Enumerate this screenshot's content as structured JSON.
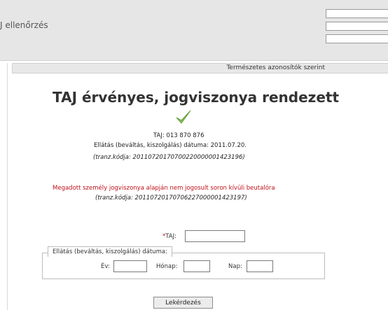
{
  "header": {
    "title": "J ellenőrzés"
  },
  "tabs": {
    "active_label": "Természetes azonosítók szerint"
  },
  "result": {
    "title": "TAJ érvényes, jogviszonya rendezett",
    "taj_line": "TAJ: 013 870 876",
    "date_line": "Ellátás (beváltás, kiszolgálás) dátuma: 2011.07.20.",
    "tranz1": "(tranz.kódja: 20110720170700220000001423196)",
    "warning": "Megadott személy jogviszonya alapján nem jogosult soron kívüli beutalóra",
    "tranz2": "(tranz.kódja: 20110720170706227000001423197)"
  },
  "form": {
    "taj_required": "*",
    "taj_label": "TAJ:",
    "taj_value": "",
    "date_legend": "Ellátás (beváltás, kiszolgálás) dátuma:",
    "ev_label": "Év:",
    "honap_label": "Hónap:",
    "nap_label": "Nap:",
    "submit_label": "Lekérdezés"
  },
  "colors": {
    "check": "#7ab648",
    "warning": "#c0111a"
  },
  "icons": {
    "status": "checkmark-icon"
  }
}
